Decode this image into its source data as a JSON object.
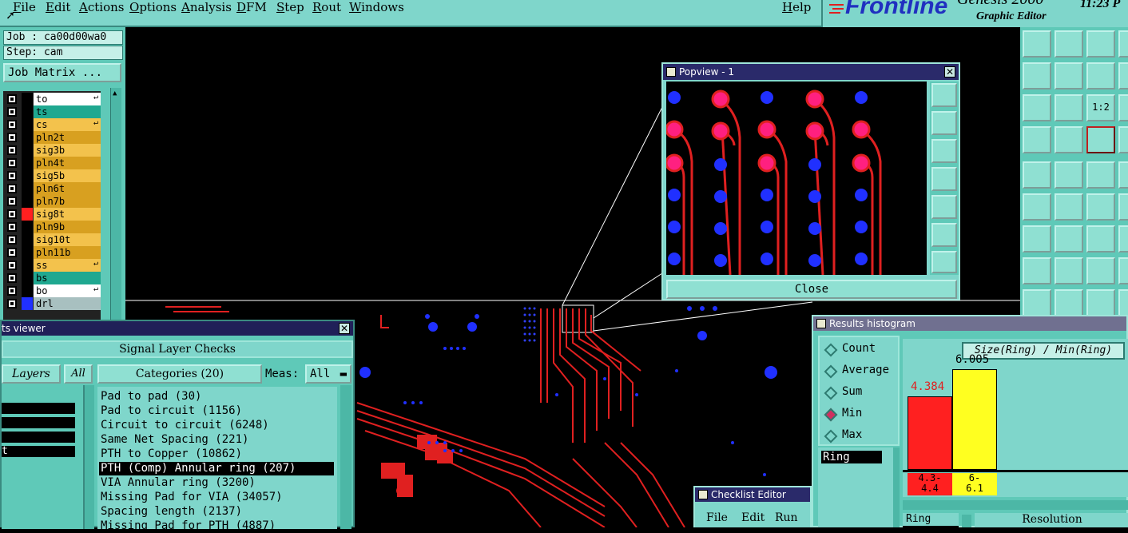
{
  "menu": {
    "items": [
      "File",
      "Edit",
      "Actions",
      "Options",
      "Analysis",
      "DFM",
      "Step",
      "Rout",
      "Windows"
    ],
    "help": "Help"
  },
  "branding": {
    "logo": "Frontline",
    "product": "Genesis 2000",
    "subtitle": "Graphic Editor",
    "clock": "11:23 P"
  },
  "job_panel": {
    "job": "Job : ca00d00wa0",
    "step": "Step: cam",
    "job_matrix_button": "Job Matrix ..."
  },
  "layers": [
    {
      "name": "to",
      "color": "#ffffff",
      "swatch": "#000000",
      "arrow": true
    },
    {
      "name": "ts",
      "color": "#1fa890",
      "swatch": "#000000",
      "arrow": false
    },
    {
      "name": "cs",
      "color": "#f3c24c",
      "swatch": "#000000",
      "arrow": true
    },
    {
      "name": "pln2t",
      "color": "#d8a020",
      "swatch": "#000000",
      "arrow": false
    },
    {
      "name": "sig3b",
      "color": "#f3c24c",
      "swatch": "#000000",
      "arrow": false
    },
    {
      "name": "pln4t",
      "color": "#d8a020",
      "swatch": "#000000",
      "arrow": false
    },
    {
      "name": "sig5b",
      "color": "#f3c24c",
      "swatch": "#000000",
      "arrow": false
    },
    {
      "name": "pln6t",
      "color": "#d8a020",
      "swatch": "#000000",
      "arrow": false
    },
    {
      "name": "pln7b",
      "color": "#d8a020",
      "swatch": "#000000",
      "arrow": false
    },
    {
      "name": "sig8t",
      "color": "#f3c24c",
      "swatch": "#ff2020",
      "arrow": false
    },
    {
      "name": "pln9b",
      "color": "#d8a020",
      "swatch": "#000000",
      "arrow": false
    },
    {
      "name": "sig10t",
      "color": "#f3c24c",
      "swatch": "#000000",
      "arrow": false
    },
    {
      "name": "pln11b",
      "color": "#d8a020",
      "swatch": "#000000",
      "arrow": false
    },
    {
      "name": "ss",
      "color": "#f3c24c",
      "swatch": "#000000",
      "arrow": true
    },
    {
      "name": "bs",
      "color": "#1fa890",
      "swatch": "#000000",
      "arrow": false
    },
    {
      "name": "bo",
      "color": "#ffffff",
      "swatch": "#000000",
      "arrow": true
    },
    {
      "name": "drl",
      "color": "#a8c0c0",
      "swatch": "#2030ff",
      "arrow": false
    }
  ],
  "popview": {
    "title": "Popview - 1",
    "close_label": "Close"
  },
  "results_viewer": {
    "title": "ts viewer",
    "header": "Signal Layer Checks",
    "layers_label": "Layers",
    "all_label": "All",
    "categories_label": "Categories (20)",
    "meas_label": "Meas:",
    "meas_value": "All",
    "categories": [
      "Pad to pad (30)",
      "Pad to circuit (1156)",
      "Circuit to circuit (6248)",
      "Same Net Spacing (221)",
      "PTH to Copper (10862)",
      "PTH (Comp) Annular ring (207)",
      "VIA Annular ring (3200)",
      "Missing Pad for VIA (34057)",
      "Spacing length (2137)",
      "Missing Pad for PTH (4887)"
    ],
    "selected_category": "PTH (Comp) Annular ring (207)",
    "layer_rows": [
      "",
      "",
      "",
      "t"
    ]
  },
  "checklist_editor": {
    "title": "Checklist Editor",
    "menu": [
      "File",
      "Edit",
      "Run"
    ]
  },
  "histogram": {
    "title": "Results histogram",
    "modes": [
      "Count",
      "Average",
      "Sum",
      "Min",
      "Max"
    ],
    "selected_mode": "Min",
    "axis_label": "Size(Ring) / Min(Ring)",
    "list_item": "Ring",
    "bottom_list_item": "Ring",
    "resolution_label": "Resolution",
    "bars": [
      {
        "value": "4.384",
        "range": "4.3-\n4.4",
        "color": "#ff2020"
      },
      {
        "value": "6.005",
        "range": "6-\n6.1",
        "color": "#ffff20"
      }
    ]
  }
}
